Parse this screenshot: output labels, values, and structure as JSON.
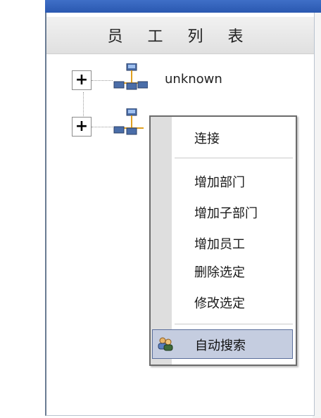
{
  "panel": {
    "header_title": "员 工 列 表"
  },
  "tree": {
    "nodes": [
      {
        "expander": "+",
        "label": "unknown"
      },
      {
        "expander": "+",
        "label": ""
      }
    ]
  },
  "context_menu": {
    "items_top": [
      {
        "label": "连接"
      }
    ],
    "items_mid": [
      {
        "label": "增加部门"
      },
      {
        "label": "增加子部门"
      },
      {
        "label": "增加员工"
      },
      {
        "label": "删除选定"
      },
      {
        "label": "修改选定"
      }
    ],
    "highlighted": {
      "label": "自动搜索",
      "icon": "users-icon"
    }
  }
}
